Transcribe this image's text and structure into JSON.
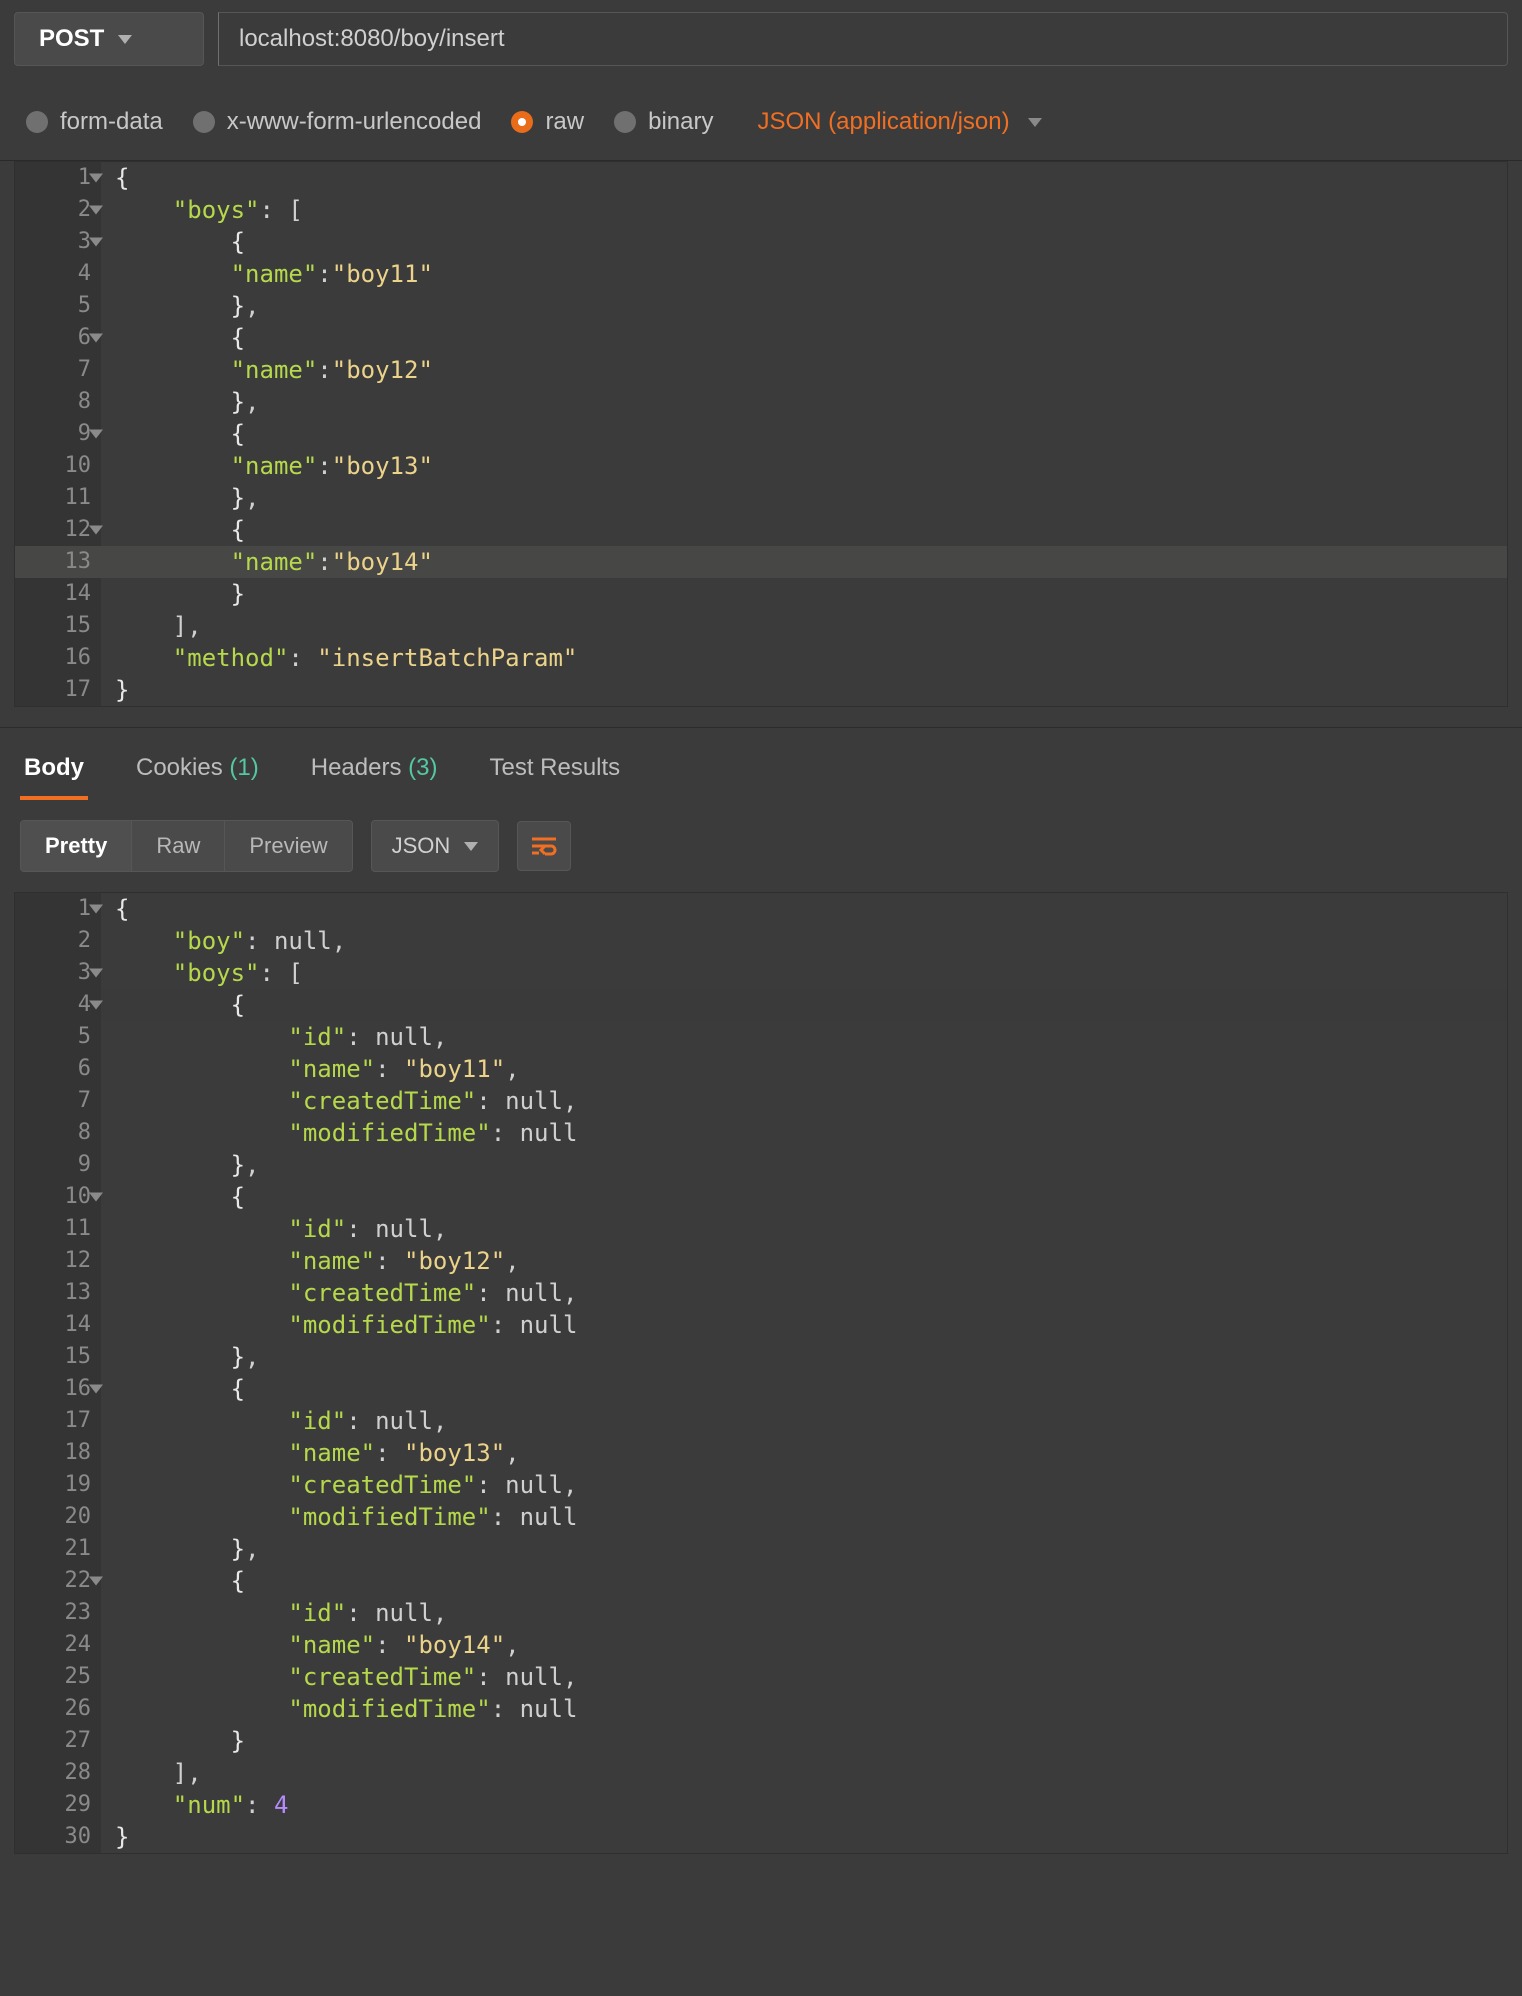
{
  "request": {
    "method": "POST",
    "url": "localhost:8080/boy/insert"
  },
  "body_types": {
    "form_data": "form-data",
    "urlencoded": "x-www-form-urlencoded",
    "raw": "raw",
    "binary": "binary",
    "selected": "raw",
    "content_type": "JSON (application/json)"
  },
  "request_body_lines": [
    {
      "n": 1,
      "fold": true,
      "indent": 0,
      "tokens": [
        [
          "brace",
          "{"
        ]
      ]
    },
    {
      "n": 2,
      "fold": true,
      "indent": 1,
      "tokens": [
        [
          "key",
          "\"boys\""
        ],
        [
          "colon",
          ":"
        ],
        [
          "punc",
          " ["
        ]
      ]
    },
    {
      "n": 3,
      "fold": true,
      "indent": 2,
      "tokens": [
        [
          "brace",
          "{"
        ]
      ]
    },
    {
      "n": 4,
      "fold": false,
      "indent": 2,
      "tokens": [
        [
          "key",
          "\"name\""
        ],
        [
          "colon",
          ":"
        ],
        [
          "string",
          "\"boy11\""
        ]
      ]
    },
    {
      "n": 5,
      "fold": false,
      "indent": 2,
      "tokens": [
        [
          "brace",
          "}"
        ],
        [
          "punc",
          ","
        ]
      ]
    },
    {
      "n": 6,
      "fold": true,
      "indent": 2,
      "tokens": [
        [
          "brace",
          "{"
        ]
      ]
    },
    {
      "n": 7,
      "fold": false,
      "indent": 2,
      "tokens": [
        [
          "key",
          "\"name\""
        ],
        [
          "colon",
          ":"
        ],
        [
          "string",
          "\"boy12\""
        ]
      ]
    },
    {
      "n": 8,
      "fold": false,
      "indent": 2,
      "tokens": [
        [
          "brace",
          "}"
        ],
        [
          "punc",
          ","
        ]
      ]
    },
    {
      "n": 9,
      "fold": true,
      "indent": 2,
      "tokens": [
        [
          "brace",
          "{"
        ]
      ]
    },
    {
      "n": 10,
      "fold": false,
      "indent": 2,
      "tokens": [
        [
          "key",
          "\"name\""
        ],
        [
          "colon",
          ":"
        ],
        [
          "string",
          "\"boy13\""
        ]
      ]
    },
    {
      "n": 11,
      "fold": false,
      "indent": 2,
      "tokens": [
        [
          "brace",
          "}"
        ],
        [
          "punc",
          ","
        ]
      ]
    },
    {
      "n": 12,
      "fold": true,
      "indent": 2,
      "tokens": [
        [
          "brace",
          "{"
        ]
      ]
    },
    {
      "n": 13,
      "fold": false,
      "indent": 2,
      "hl": true,
      "tokens": [
        [
          "key",
          "\"name\""
        ],
        [
          "colon",
          ":"
        ],
        [
          "string",
          "\"boy14\""
        ]
      ]
    },
    {
      "n": 14,
      "fold": false,
      "indent": 2,
      "tokens": [
        [
          "brace",
          "}"
        ]
      ]
    },
    {
      "n": 15,
      "fold": false,
      "indent": 1,
      "tokens": [
        [
          "punc",
          "]"
        ],
        [
          "punc",
          ","
        ]
      ]
    },
    {
      "n": 16,
      "fold": false,
      "indent": 1,
      "tokens": [
        [
          "key",
          "\"method\""
        ],
        [
          "colon",
          ":"
        ],
        [
          "punc",
          " "
        ],
        [
          "string",
          "\"insertBatchParam\""
        ]
      ]
    },
    {
      "n": 17,
      "fold": false,
      "indent": 0,
      "tokens": [
        [
          "brace",
          "}"
        ]
      ]
    }
  ],
  "response_tabs": {
    "body": "Body",
    "cookies_label": "Cookies",
    "cookies_count": "(1)",
    "headers_label": "Headers",
    "headers_count": "(3)",
    "test_results": "Test Results"
  },
  "response_view": {
    "pretty": "Pretty",
    "raw": "Raw",
    "preview": "Preview",
    "format": "JSON"
  },
  "response_body_lines": [
    {
      "n": 1,
      "fold": true,
      "indent": 0,
      "tokens": [
        [
          "brace",
          "{"
        ]
      ]
    },
    {
      "n": 2,
      "fold": false,
      "indent": 1,
      "tokens": [
        [
          "key",
          "\"boy\""
        ],
        [
          "colon",
          ":"
        ],
        [
          "punc",
          " "
        ],
        [
          "null",
          "null"
        ],
        [
          "punc",
          ","
        ]
      ]
    },
    {
      "n": 3,
      "fold": true,
      "indent": 1,
      "tokens": [
        [
          "key",
          "\"boys\""
        ],
        [
          "colon",
          ":"
        ],
        [
          "punc",
          " ["
        ]
      ]
    },
    {
      "n": 4,
      "fold": true,
      "indent": 2,
      "indent_hl": true,
      "tokens": [
        [
          "brace",
          "{"
        ]
      ]
    },
    {
      "n": 5,
      "fold": false,
      "indent": 3,
      "tokens": [
        [
          "key",
          "\"id\""
        ],
        [
          "colon",
          ":"
        ],
        [
          "punc",
          " "
        ],
        [
          "null",
          "null"
        ],
        [
          "punc",
          ","
        ]
      ]
    },
    {
      "n": 6,
      "fold": false,
      "indent": 3,
      "tokens": [
        [
          "key",
          "\"name\""
        ],
        [
          "colon",
          ":"
        ],
        [
          "punc",
          " "
        ],
        [
          "string",
          "\"boy11\""
        ],
        [
          "punc",
          ","
        ]
      ]
    },
    {
      "n": 7,
      "fold": false,
      "indent": 3,
      "tokens": [
        [
          "key",
          "\"createdTime\""
        ],
        [
          "colon",
          ":"
        ],
        [
          "punc",
          " "
        ],
        [
          "null",
          "null"
        ],
        [
          "punc",
          ","
        ]
      ]
    },
    {
      "n": 8,
      "fold": false,
      "indent": 3,
      "tokens": [
        [
          "key",
          "\"modifiedTime\""
        ],
        [
          "colon",
          ":"
        ],
        [
          "punc",
          " "
        ],
        [
          "null",
          "null"
        ]
      ]
    },
    {
      "n": 9,
      "fold": false,
      "indent": 2,
      "tokens": [
        [
          "brace",
          "}"
        ],
        [
          "punc",
          ","
        ]
      ]
    },
    {
      "n": 10,
      "fold": true,
      "indent": 2,
      "tokens": [
        [
          "brace",
          "{"
        ]
      ]
    },
    {
      "n": 11,
      "fold": false,
      "indent": 3,
      "tokens": [
        [
          "key",
          "\"id\""
        ],
        [
          "colon",
          ":"
        ],
        [
          "punc",
          " "
        ],
        [
          "null",
          "null"
        ],
        [
          "punc",
          ","
        ]
      ]
    },
    {
      "n": 12,
      "fold": false,
      "indent": 3,
      "tokens": [
        [
          "key",
          "\"name\""
        ],
        [
          "colon",
          ":"
        ],
        [
          "punc",
          " "
        ],
        [
          "string",
          "\"boy12\""
        ],
        [
          "punc",
          ","
        ]
      ]
    },
    {
      "n": 13,
      "fold": false,
      "indent": 3,
      "tokens": [
        [
          "key",
          "\"createdTime\""
        ],
        [
          "colon",
          ":"
        ],
        [
          "punc",
          " "
        ],
        [
          "null",
          "null"
        ],
        [
          "punc",
          ","
        ]
      ]
    },
    {
      "n": 14,
      "fold": false,
      "indent": 3,
      "tokens": [
        [
          "key",
          "\"modifiedTime\""
        ],
        [
          "colon",
          ":"
        ],
        [
          "punc",
          " "
        ],
        [
          "null",
          "null"
        ]
      ]
    },
    {
      "n": 15,
      "fold": false,
      "indent": 2,
      "tokens": [
        [
          "brace",
          "}"
        ],
        [
          "punc",
          ","
        ]
      ]
    },
    {
      "n": 16,
      "fold": true,
      "indent": 2,
      "tokens": [
        [
          "brace",
          "{"
        ]
      ]
    },
    {
      "n": 17,
      "fold": false,
      "indent": 3,
      "tokens": [
        [
          "key",
          "\"id\""
        ],
        [
          "colon",
          ":"
        ],
        [
          "punc",
          " "
        ],
        [
          "null",
          "null"
        ],
        [
          "punc",
          ","
        ]
      ]
    },
    {
      "n": 18,
      "fold": false,
      "indent": 3,
      "tokens": [
        [
          "key",
          "\"name\""
        ],
        [
          "colon",
          ":"
        ],
        [
          "punc",
          " "
        ],
        [
          "string",
          "\"boy13\""
        ],
        [
          "punc",
          ","
        ]
      ]
    },
    {
      "n": 19,
      "fold": false,
      "indent": 3,
      "tokens": [
        [
          "key",
          "\"createdTime\""
        ],
        [
          "colon",
          ":"
        ],
        [
          "punc",
          " "
        ],
        [
          "null",
          "null"
        ],
        [
          "punc",
          ","
        ]
      ]
    },
    {
      "n": 20,
      "fold": false,
      "indent": 3,
      "tokens": [
        [
          "key",
          "\"modifiedTime\""
        ],
        [
          "colon",
          ":"
        ],
        [
          "punc",
          " "
        ],
        [
          "null",
          "null"
        ]
      ]
    },
    {
      "n": 21,
      "fold": false,
      "indent": 2,
      "tokens": [
        [
          "brace",
          "}"
        ],
        [
          "punc",
          ","
        ]
      ]
    },
    {
      "n": 22,
      "fold": true,
      "indent": 2,
      "tokens": [
        [
          "brace",
          "{"
        ]
      ]
    },
    {
      "n": 23,
      "fold": false,
      "indent": 3,
      "tokens": [
        [
          "key",
          "\"id\""
        ],
        [
          "colon",
          ":"
        ],
        [
          "punc",
          " "
        ],
        [
          "null",
          "null"
        ],
        [
          "punc",
          ","
        ]
      ]
    },
    {
      "n": 24,
      "fold": false,
      "indent": 3,
      "tokens": [
        [
          "key",
          "\"name\""
        ],
        [
          "colon",
          ":"
        ],
        [
          "punc",
          " "
        ],
        [
          "string",
          "\"boy14\""
        ],
        [
          "punc",
          ","
        ]
      ]
    },
    {
      "n": 25,
      "fold": false,
      "indent": 3,
      "tokens": [
        [
          "key",
          "\"createdTime\""
        ],
        [
          "colon",
          ":"
        ],
        [
          "punc",
          " "
        ],
        [
          "null",
          "null"
        ],
        [
          "punc",
          ","
        ]
      ]
    },
    {
      "n": 26,
      "fold": false,
      "indent": 3,
      "tokens": [
        [
          "key",
          "\"modifiedTime\""
        ],
        [
          "colon",
          ":"
        ],
        [
          "punc",
          " "
        ],
        [
          "null",
          "null"
        ]
      ]
    },
    {
      "n": 27,
      "fold": false,
      "indent": 2,
      "tokens": [
        [
          "brace",
          "}"
        ]
      ]
    },
    {
      "n": 28,
      "fold": false,
      "indent": 1,
      "tokens": [
        [
          "punc",
          "]"
        ],
        [
          "punc",
          ","
        ]
      ]
    },
    {
      "n": 29,
      "fold": false,
      "indent": 1,
      "tokens": [
        [
          "key",
          "\"num\""
        ],
        [
          "colon",
          ":"
        ],
        [
          "punc",
          " "
        ],
        [
          "num",
          "4"
        ]
      ]
    },
    {
      "n": 30,
      "fold": false,
      "indent": 0,
      "tokens": [
        [
          "brace",
          "}"
        ]
      ]
    }
  ]
}
